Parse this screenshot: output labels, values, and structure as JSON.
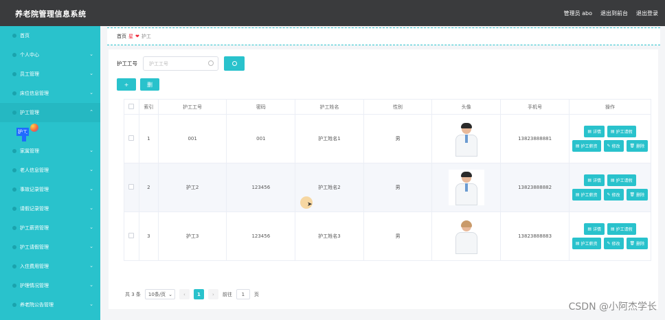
{
  "header": {
    "title": "养老院管理信息系统",
    "user": "管理员 abo",
    "back_to_front": "退出到前台",
    "logout": "退出登录"
  },
  "sidebar": {
    "items": [
      {
        "label": "首页",
        "icon": "home-icon"
      },
      {
        "label": "个人中心",
        "icon": "user-icon",
        "chevron": "⌄"
      },
      {
        "label": "员工管理",
        "icon": "staff-icon",
        "chevron": "⌄"
      },
      {
        "label": "床位信息管理",
        "icon": "bed-icon",
        "chevron": "⌄"
      },
      {
        "label": "护工管理",
        "icon": "nurse-icon",
        "chevron": "⌃"
      },
      {
        "label": "家属管理",
        "icon": "family-icon",
        "chevron": "⌄"
      },
      {
        "label": "老人信息管理",
        "icon": "elder-icon",
        "chevron": "⌄"
      },
      {
        "label": "事故记录管理",
        "icon": "accident-icon",
        "chevron": "⌄"
      },
      {
        "label": "请假记录管理",
        "icon": "leave-icon",
        "chevron": "⌄"
      },
      {
        "label": "护工薪资管理",
        "icon": "salary-icon",
        "chevron": "⌄"
      },
      {
        "label": "护工请假管理",
        "icon": "nurse-leave-icon",
        "chevron": "⌄"
      },
      {
        "label": "入住费用管理",
        "icon": "fee-icon",
        "chevron": "⌄"
      },
      {
        "label": "护理情况管理",
        "icon": "care-icon",
        "chevron": "⌄"
      },
      {
        "label": "养老院公告管理",
        "icon": "notice-icon",
        "chevron": "⌄"
      }
    ],
    "submenu_active": "护工"
  },
  "breadcrumb": {
    "home": "首页",
    "heart": "❤",
    "sep": "星",
    "current": "护工"
  },
  "search": {
    "label": "护工工号",
    "placeholder": "护工工号"
  },
  "actions": {
    "add": "+",
    "delete": "删"
  },
  "table": {
    "headers": [
      "索引",
      "护工工号",
      "密码",
      "护工姓名",
      "性别",
      "头像",
      "手机号",
      "操作"
    ],
    "rows": [
      {
        "index": "1",
        "id": "001",
        "password": "001",
        "name": "护工姓名1",
        "gender": "男",
        "avatar": "male",
        "phone": "13823888881"
      },
      {
        "index": "2",
        "id": "护工2",
        "password": "123456",
        "name": "护工姓名2",
        "gender": "男",
        "avatar": "male",
        "phone": "13823888882"
      },
      {
        "index": "3",
        "id": "护工3",
        "password": "123456",
        "name": "护工姓名3",
        "gender": "男",
        "avatar": "female",
        "phone": "13823888883"
      }
    ],
    "ops": {
      "detail": "详情",
      "leave": "护工请假",
      "salary": "护工薪资",
      "edit": "修改",
      "delete": "删除"
    }
  },
  "pager": {
    "total": "共 3 条",
    "page_size": "10条/页",
    "current": "1",
    "goto": "前往",
    "goto_value": "1",
    "page_unit": "页"
  },
  "watermark": "CSDN @小阿杰学长",
  "colors": {
    "accent": "#29c2cc",
    "topbar": "#3a3b3d"
  }
}
